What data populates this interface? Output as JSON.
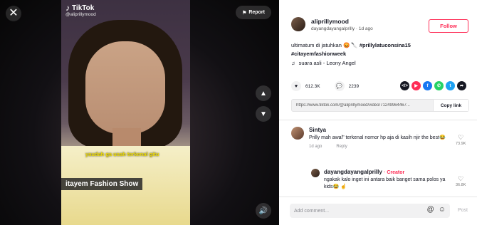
{
  "video": {
    "close_icon": "✕",
    "logo_text": "TikTok",
    "watermark_handle": "@aliprillymood",
    "subtitle": "yaudah ga usah terkenal gitu",
    "banner": "itayem Fashion Show",
    "report_label": "Report"
  },
  "author": {
    "username": "aliprillymood",
    "display_name": "dayangdayangalprilly",
    "age": "1d ago",
    "follow_label": "Follow"
  },
  "caption": {
    "text": "ultimatum di jatuhkan 😡 🔪",
    "tag1": "#prillylatuconsina15",
    "tag2": "#citayemfashionweek",
    "music": "suara asli - Leony Angel"
  },
  "stats": {
    "likes": "612.3K",
    "comments": "2239"
  },
  "share": {
    "url": "https://www.tiktok.com/@aliprillymood/video/71249964467...",
    "copy_label": "Copy link",
    "icons": [
      {
        "name": "embed-icon",
        "glyph": "</>",
        "color": "#161823"
      },
      {
        "name": "send-icon",
        "glyph": "▶",
        "color": "#fe2c55"
      },
      {
        "name": "facebook-icon",
        "glyph": "f",
        "color": "#1877f2"
      },
      {
        "name": "whatsapp-icon",
        "glyph": "✆",
        "color": "#25d366"
      },
      {
        "name": "twitter-icon",
        "glyph": "t",
        "color": "#1da1f2"
      },
      {
        "name": "share-arrow-icon",
        "glyph": "➦",
        "color": "#161823"
      }
    ]
  },
  "comments": [
    {
      "name": "Sintya",
      "text": "Prilly mah awal\" terkenal nomor hp aja di kasih njir the best😂",
      "age": "1d ago",
      "reply_label": "Reply",
      "likes": "73.9K"
    },
    {
      "name": "dayangdayangalprilly",
      "badge": "· Creator",
      "text": "ngakak kalo inget ini antara baik banget sama polos ya kids😂 ☝",
      "likes": "36.8K"
    }
  ],
  "comment_bar": {
    "placeholder": "Add comment...",
    "post_label": "Post"
  },
  "colors": {
    "accent": "#fe2c55",
    "subtitle": "#f3df00"
  }
}
